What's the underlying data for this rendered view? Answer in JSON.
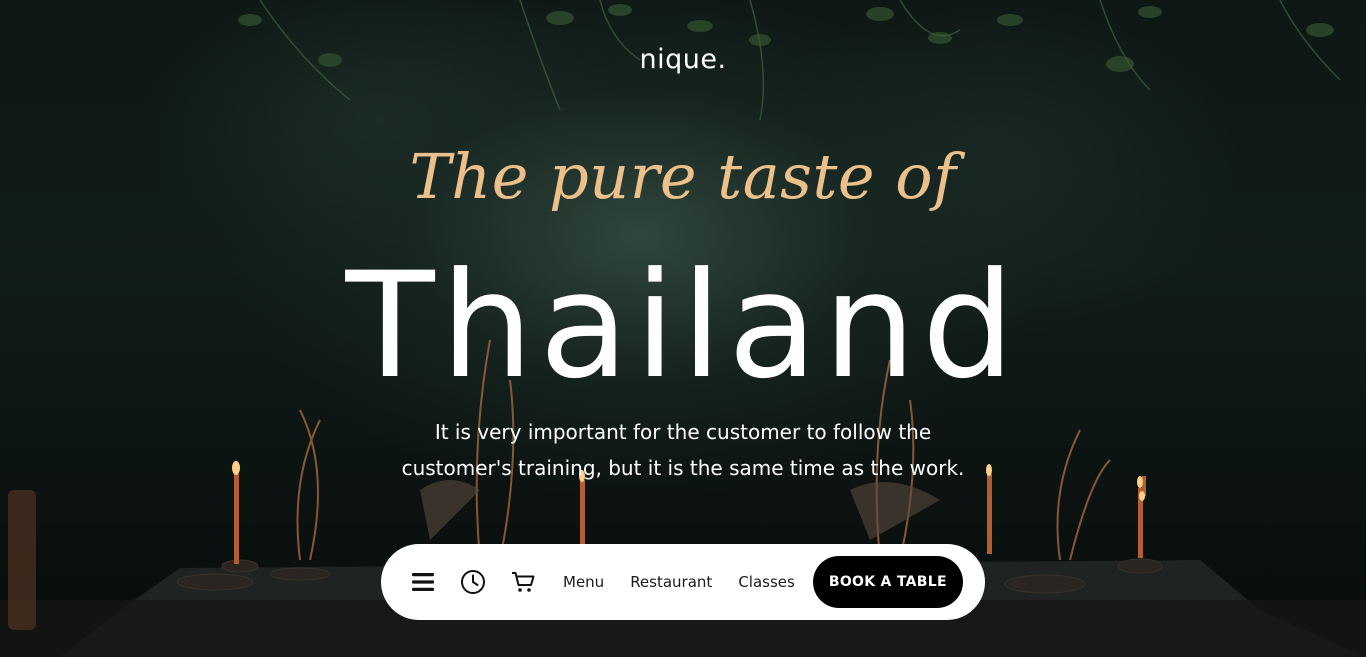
{
  "brand": {
    "logo_text": "nique."
  },
  "hero": {
    "tagline": "The pure taste of",
    "headline": "Thailand",
    "description": "It is very important for the customer to follow the customer's training, but it is the same time as the work."
  },
  "navbar": {
    "icons": [
      "menu-icon",
      "clock-icon",
      "cart-icon"
    ],
    "links": [
      "Menu",
      "Restaurant",
      "Classes"
    ],
    "cta_label": "BOOK A TABLE"
  },
  "colors": {
    "tagline": "#ecc08a",
    "headline": "#ffffff",
    "navbar_bg": "#ffffff",
    "cta_bg": "#000000",
    "cta_text": "#ffffff"
  }
}
